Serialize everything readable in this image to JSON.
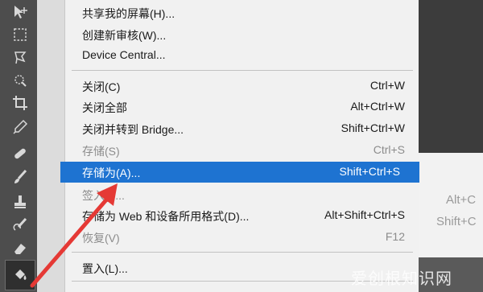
{
  "menu": {
    "items": [
      {
        "label": "共享我的屏幕(H)...",
        "shortcut": ""
      },
      {
        "label": "创建新审核(W)...",
        "shortcut": ""
      },
      {
        "label": "Device Central...",
        "shortcut": ""
      },
      {
        "label": "关闭(C)",
        "shortcut": "Ctrl+W"
      },
      {
        "label": "关闭全部",
        "shortcut": "Alt+Ctrl+W"
      },
      {
        "label": "关闭并转到 Bridge...",
        "shortcut": "Shift+Ctrl+W"
      },
      {
        "label": "存储(S)",
        "shortcut": "Ctrl+S"
      },
      {
        "label": "存储为(A)...",
        "shortcut": "Shift+Ctrl+S"
      },
      {
        "label": "签入(I)...",
        "shortcut": ""
      },
      {
        "label": "存储为 Web 和设备所用格式(D)...",
        "shortcut": "Alt+Shift+Ctrl+S"
      },
      {
        "label": "恢复(V)",
        "shortcut": "F12"
      },
      {
        "label": "置入(L)...",
        "shortcut": ""
      }
    ]
  },
  "background": {
    "ghost_shortcut_1": "Alt+C",
    "ghost_shortcut_2": "Shift+C"
  },
  "watermark": "爱创根知识网",
  "colors": {
    "selection": "#1e73d1",
    "arrow": "#e53935"
  },
  "tools": [
    "move-icon",
    "marquee-icon",
    "lasso-icon",
    "quick-select-icon",
    "crop-icon",
    "eyedropper-icon",
    "healing-brush-icon",
    "brush-icon",
    "clone-stamp-icon",
    "history-brush-icon",
    "eraser-icon",
    "paint-bucket-icon"
  ]
}
